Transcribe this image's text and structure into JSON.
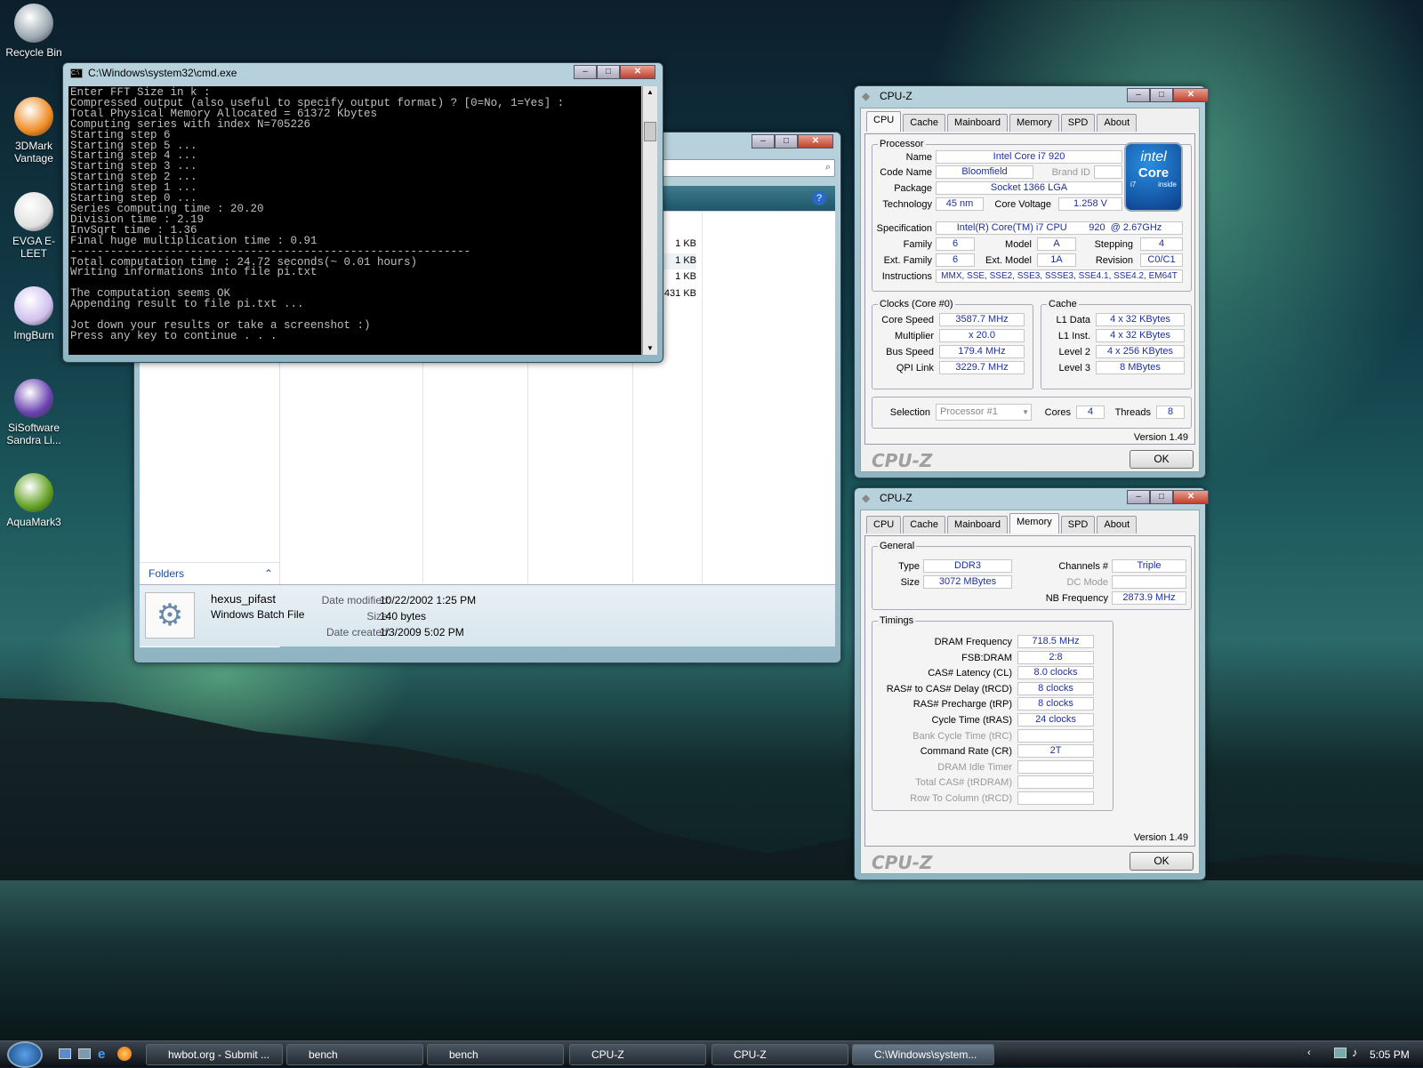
{
  "desktop": {
    "icons": [
      {
        "label": "Recycle Bin",
        "icon": "recycle-bin-icon",
        "color": "#9aa7b0"
      },
      {
        "label": "3DMark Vantage",
        "icon": "3dmark-icon",
        "color": "#f08a20"
      },
      {
        "label": "EVGA E-LEET",
        "icon": "evga-icon",
        "color": "#e0e0e0"
      },
      {
        "label": "ImgBurn",
        "icon": "imgburn-icon",
        "color": "#d0c0f0"
      },
      {
        "label": "SiSoftware Sandra Li...",
        "icon": "sandra-icon",
        "color": "#6a40b0"
      },
      {
        "label": "AquaMark3",
        "icon": "aquamark-icon",
        "color": "#60a020"
      }
    ]
  },
  "cmd": {
    "title": "C:\\Windows\\system32\\cmd.exe",
    "lines": [
      "Enter FFT Size in k :",
      "Compressed output (also useful to specify output format) ? [0=No, 1=Yes] :",
      "Total Physical Memory Allocated = 61372 Kbytes",
      "Computing series with index N=705226",
      "Starting step 6",
      "Starting step 5 ...",
      "Starting step 4 ...",
      "Starting step 3 ...",
      "Starting step 2 ...",
      "Starting step 1 ...",
      "Starting step 0 ...",
      "Series computing time : 20.20",
      "Division time : 2.19",
      "InvSqrt time : 1.36",
      "Final huge multiplication time : 0.91",
      "------------------------------------------------------------",
      "Total computation time : 24.72 seconds(~ 0.01 hours)",
      "Writing informations into file pi.txt",
      "",
      "The computation seems OK",
      "Appending result to file pi.txt ...",
      "",
      "Jot down your results or take a screenshot :)",
      "Press any key to continue . . ."
    ]
  },
  "explorer": {
    "sizes": [
      "1 KB",
      "1 KB",
      "1 KB",
      "431 KB"
    ],
    "folders_label": "Folders",
    "file": {
      "name": "hexus_pifast",
      "type": "Windows Batch File",
      "modified_label": "Date modified:",
      "modified": "10/22/2002 1:25 PM",
      "size_label": "Size:",
      "size": "140 bytes",
      "created_label": "Date created:",
      "created": "1/3/2009 5:02 PM"
    }
  },
  "cpuz1": {
    "title": "CPU-Z",
    "tabs": [
      "CPU",
      "Cache",
      "Mainboard",
      "Memory",
      "SPD",
      "About"
    ],
    "processor": "Processor",
    "labels": {
      "name": "Name",
      "codename": "Code Name",
      "brandid": "Brand ID",
      "package": "Package",
      "tech": "Technology",
      "voltage": "Core Voltage",
      "spec": "Specification",
      "family": "Family",
      "model": "Model",
      "stepping": "Stepping",
      "extfamily": "Ext. Family",
      "extmodel": "Ext. Model",
      "revision": "Revision",
      "instr": "Instructions"
    },
    "values": {
      "name": "Intel Core i7 920",
      "codename": "Bloomfield",
      "package": "Socket 1366 LGA",
      "tech": "45 nm",
      "voltage": "1.258 V",
      "spec": "Intel(R) Core(TM) i7 CPU        920  @ 2.67GHz",
      "family": "6",
      "model": "A",
      "stepping": "4",
      "extfamily": "6",
      "extmodel": "1A",
      "revision": "C0/C1",
      "instr": "MMX, SSE, SSE2, SSE3, SSSE3, SSE4.1, SSE4.2, EM64T"
    },
    "intel_logo": {
      "line1": "intel",
      "line2": "Core",
      "line3": "i7",
      "line4": "inside"
    },
    "clocks": {
      "title": "Clocks (Core #0)",
      "speed_l": "Core Speed",
      "speed": "3587.7 MHz",
      "mult_l": "Multiplier",
      "mult": "x 20.0",
      "bus_l": "Bus Speed",
      "bus": "179.4 MHz",
      "qpi_l": "QPI Link",
      "qpi": "3229.7 MHz"
    },
    "cache": {
      "title": "Cache",
      "l1d_l": "L1 Data",
      "l1d": "4 x 32 KBytes",
      "l1i_l": "L1 Inst.",
      "l1i": "4 x 32 KBytes",
      "l2_l": "Level 2",
      "l2": "4 x 256 KBytes",
      "l3_l": "Level 3",
      "l3": "8 MBytes"
    },
    "sel_l": "Selection",
    "sel": "Processor #1",
    "cores_l": "Cores",
    "cores": "4",
    "threads_l": "Threads",
    "threads": "8",
    "version": "Version 1.49",
    "logo": "CPU-Z",
    "ok": "OK"
  },
  "cpuz2": {
    "title": "CPU-Z",
    "tabs": [
      "CPU",
      "Cache",
      "Mainboard",
      "Memory",
      "SPD",
      "About"
    ],
    "general": {
      "title": "General",
      "type_l": "Type",
      "type": "DDR3",
      "size_l": "Size",
      "size": "3072 MBytes",
      "channels_l": "Channels #",
      "channels": "Triple",
      "dc_l": "DC Mode",
      "nb_l": "NB Frequency",
      "nb": "2873.9 MHz"
    },
    "timings": {
      "title": "Timings",
      "rows": [
        {
          "l": "DRAM Frequency",
          "v": "718.5 MHz",
          "dim": false
        },
        {
          "l": "FSB:DRAM",
          "v": "2:8",
          "dim": false
        },
        {
          "l": "CAS# Latency (CL)",
          "v": "8.0 clocks",
          "dim": false
        },
        {
          "l": "RAS# to CAS# Delay (tRCD)",
          "v": "8 clocks",
          "dim": false
        },
        {
          "l": "RAS# Precharge (tRP)",
          "v": "8 clocks",
          "dim": false
        },
        {
          "l": "Cycle Time (tRAS)",
          "v": "24 clocks",
          "dim": false
        },
        {
          "l": "Bank Cycle Time (tRC)",
          "v": "",
          "dim": true
        },
        {
          "l": "Command Rate (CR)",
          "v": "2T",
          "dim": false
        },
        {
          "l": "DRAM Idle Timer",
          "v": "",
          "dim": true
        },
        {
          "l": "Total CAS# (tRDRAM)",
          "v": "",
          "dim": true
        },
        {
          "l": "Row To Column (tRCD)",
          "v": "",
          "dim": true
        }
      ]
    },
    "version": "Version 1.49",
    "logo": "CPU-Z",
    "ok": "OK"
  },
  "taskbar": {
    "buttons": [
      "hwbot.org - Submit ...",
      "bench",
      "bench",
      "CPU-Z",
      "CPU-Z",
      "C:\\Windows\\system..."
    ],
    "clock": "5:05 PM"
  }
}
